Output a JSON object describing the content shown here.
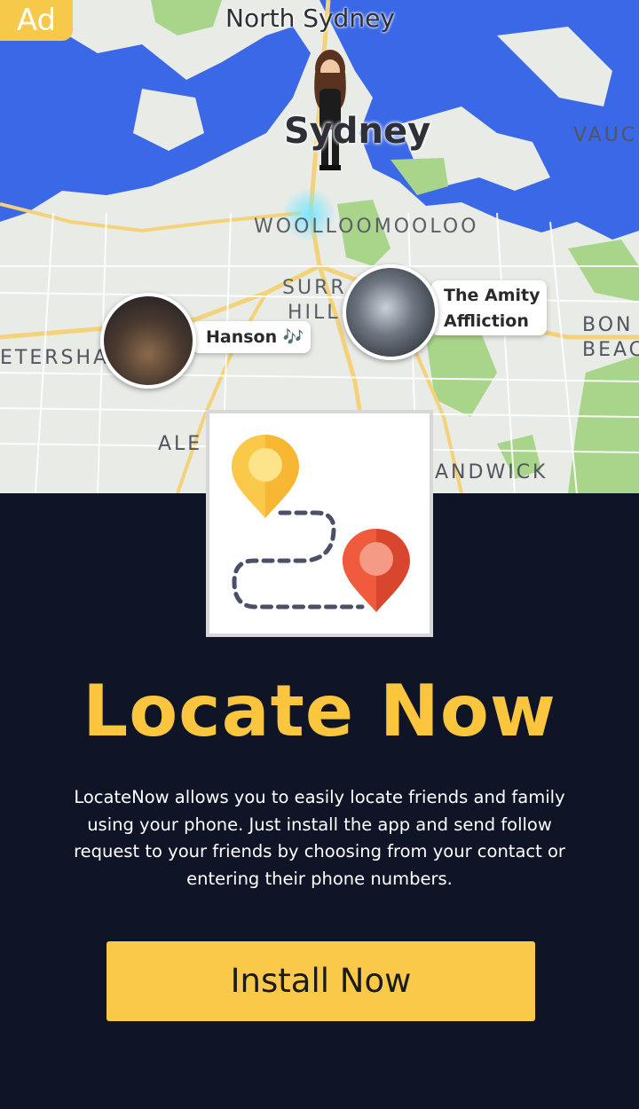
{
  "ad_badge": "Ad",
  "map": {
    "labels": {
      "north_sydney": "North Sydney",
      "sydney": "Sydney",
      "vaucluse": "VAUC",
      "woolloomooloo": "WOOLLOOMOOLOO",
      "surry_1": "SURR",
      "surry_2": "HILL",
      "petersham": "ETERSHA",
      "bondi_1": "BON",
      "bondi_2": "BEAC",
      "alexandria": "ALE",
      "randwick": "ANDWICK"
    },
    "stories": [
      {
        "label": "Hanson 🎶"
      },
      {
        "label_line1": "The Amity",
        "label_line2": "Affliction"
      }
    ],
    "colors": {
      "water": "#3a68e6",
      "park": "#a8d58a",
      "land": "#e9ebe7",
      "road": "#f3d27a"
    }
  },
  "app_icon": {
    "name": "route-pins-icon"
  },
  "headline": "Locate Now",
  "description": "LocateNow allows you to easily locate friends and family using your phone. Just install the app and send follow request to your friends by choosing from your contact or entering their phone numbers.",
  "cta": {
    "label": "Install Now"
  },
  "colors": {
    "background": "#0f1526",
    "accent": "#fbc63e",
    "button": "#fbc94a"
  }
}
